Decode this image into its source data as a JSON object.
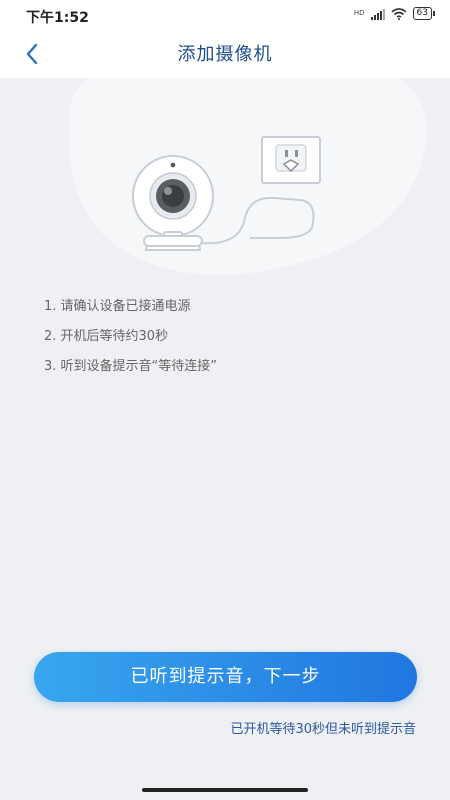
{
  "status_bar": {
    "time": "下午1:52",
    "hd_label": "HD",
    "battery_level": "63",
    "icons": [
      "signal-icon",
      "wifi-icon",
      "battery-icon"
    ]
  },
  "nav": {
    "title": "添加摄像机",
    "back_icon": "chevron-left-icon"
  },
  "steps": [
    "1.  请确认设备已接通电源",
    "2.  开机后等待约30秒",
    "3.  听到设备提示音“等待连接”"
  ],
  "actions": {
    "primary_label": "已听到提示音，下一步",
    "secondary_label": "已开机等待30秒但未听到提示音"
  },
  "colors": {
    "title": "#1f4f8a",
    "button_start": "#38a6ee",
    "button_end": "#2176e0",
    "link": "#2a5aa0",
    "background": "#eef0f3"
  }
}
